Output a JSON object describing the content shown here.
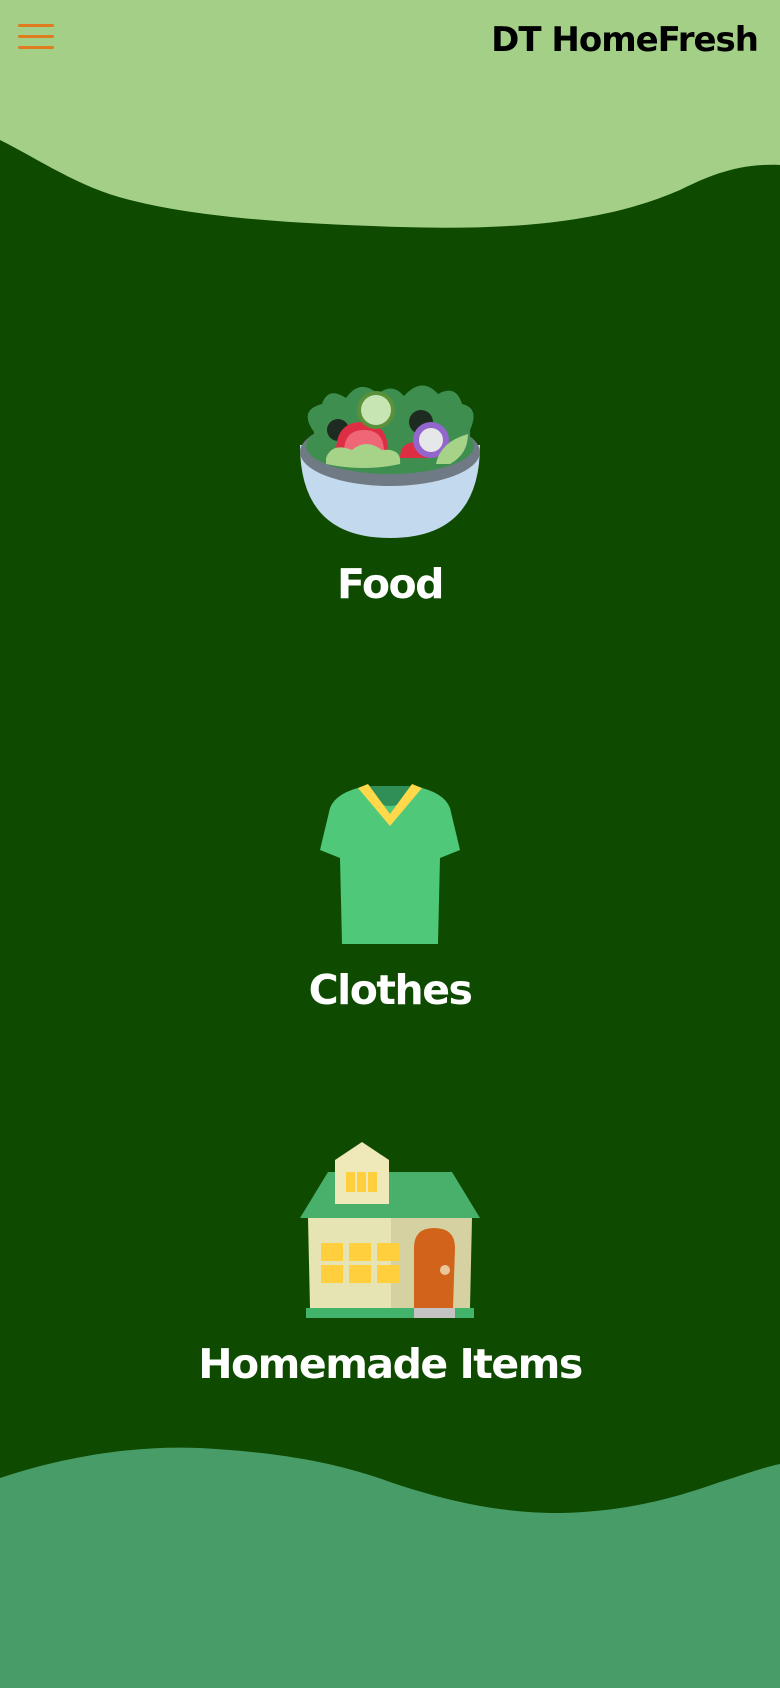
{
  "header": {
    "title": "DT HomeFresh",
    "menu_icon": "hamburger-menu-icon"
  },
  "categories": [
    {
      "label": "Food",
      "icon": "salad-bowl-icon"
    },
    {
      "label": "Clothes",
      "icon": "t-shirt-icon"
    },
    {
      "label": "Homemade Items",
      "icon": "house-icon"
    }
  ],
  "colors": {
    "background": "#0e4a00",
    "top_wave": "#a3cf87",
    "bottom_wave": "#489c68",
    "menu_icon": "#e07b1f",
    "title": "#000000",
    "label": "#ffffff"
  }
}
